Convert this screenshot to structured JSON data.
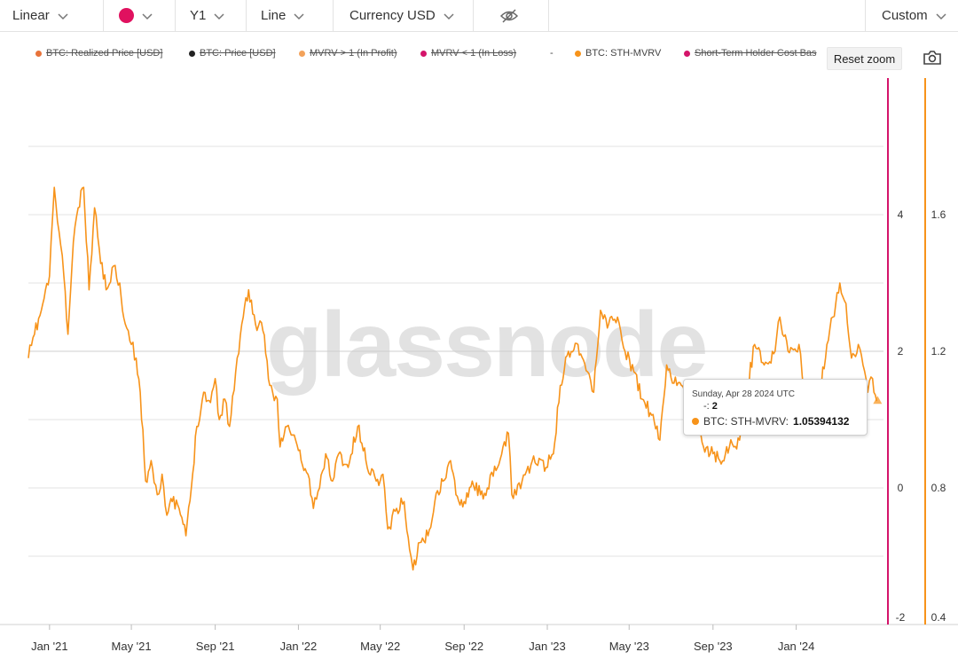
{
  "toolbar": {
    "scale": "Linear",
    "color": "#e0115f",
    "axis": "Y1",
    "line_type": "Line",
    "currency": "Currency USD",
    "range": "Custom"
  },
  "legend": {
    "items": [
      {
        "label": "BTC: Realized Price [USD]",
        "color": "#e8733a",
        "off": true
      },
      {
        "label": "BTC: Price [USD]",
        "color": "#222222",
        "off": true
      },
      {
        "label": "MVRV > 1 (In Profit)",
        "color": "#f3a25a",
        "off": true
      },
      {
        "label": "MVRV < 1 (In Loss)",
        "color": "#d4146a",
        "off": true
      },
      {
        "label": "-",
        "color": "",
        "off": false
      },
      {
        "label": "BTC: STH-MVRV",
        "color": "#f7931a",
        "off": false
      },
      {
        "label": "Short-Term Holder Cost Bas",
        "color": "#d4146a",
        "off": true
      }
    ]
  },
  "reset_zoom": "Reset zoom",
  "watermark": "glassnode",
  "tooltip": {
    "date": "Sunday, Apr 28 2024 UTC",
    "ref_label": "-:",
    "ref_value": "2",
    "series_label": "BTC: STH-MVRV:",
    "series_value": "1.05394132"
  },
  "chart_data": {
    "type": "line",
    "x_ticks": [
      "Jan '21",
      "May '21",
      "Sep '21",
      "Jan '22",
      "May '22",
      "Sep '22",
      "Jan '23",
      "May '23",
      "Sep '23",
      "Jan '24"
    ],
    "y_left_ticks": [
      "-2",
      "0",
      "2",
      "4"
    ],
    "y_right_ticks": [
      "0.4",
      "0.8",
      "1.2",
      "1.6"
    ],
    "y_left_range": [
      -2,
      6
    ],
    "y_right_range": [
      0.4,
      2.0
    ],
    "reference_value": 2,
    "reference_color": "#d4146a",
    "grid": true,
    "legend_position": "top",
    "series": [
      {
        "name": "BTC: STH-MVRV",
        "color": "#f7931a",
        "axis": "right",
        "points": [
          [
            "2020-12-01",
            1.18
          ],
          [
            "2020-12-10",
            1.25
          ],
          [
            "2020-12-20",
            1.32
          ],
          [
            "2021-01-01",
            1.42
          ],
          [
            "2021-01-08",
            1.68
          ],
          [
            "2021-01-15",
            1.55
          ],
          [
            "2021-01-22",
            1.42
          ],
          [
            "2021-01-28",
            1.25
          ],
          [
            "2021-02-05",
            1.52
          ],
          [
            "2021-02-12",
            1.62
          ],
          [
            "2021-02-20",
            1.68
          ],
          [
            "2021-02-28",
            1.38
          ],
          [
            "2021-03-08",
            1.62
          ],
          [
            "2021-03-15",
            1.5
          ],
          [
            "2021-03-25",
            1.38
          ],
          [
            "2021-04-05",
            1.45
          ],
          [
            "2021-04-14",
            1.4
          ],
          [
            "2021-04-22",
            1.28
          ],
          [
            "2021-05-01",
            1.22
          ],
          [
            "2021-05-08",
            1.18
          ],
          [
            "2021-05-14",
            1.08
          ],
          [
            "2021-05-22",
            0.82
          ],
          [
            "2021-05-30",
            0.88
          ],
          [
            "2021-06-08",
            0.78
          ],
          [
            "2021-06-15",
            0.84
          ],
          [
            "2021-06-22",
            0.72
          ],
          [
            "2021-06-30",
            0.76
          ],
          [
            "2021-07-10",
            0.74
          ],
          [
            "2021-07-20",
            0.66
          ],
          [
            "2021-07-28",
            0.8
          ],
          [
            "2021-08-05",
            0.98
          ],
          [
            "2021-08-15",
            1.08
          ],
          [
            "2021-08-25",
            1.05
          ],
          [
            "2021-09-01",
            1.12
          ],
          [
            "2021-09-07",
            1.0
          ],
          [
            "2021-09-15",
            1.06
          ],
          [
            "2021-09-22",
            0.98
          ],
          [
            "2021-10-01",
            1.14
          ],
          [
            "2021-10-10",
            1.28
          ],
          [
            "2021-10-20",
            1.38
          ],
          [
            "2021-10-30",
            1.28
          ],
          [
            "2021-11-10",
            1.26
          ],
          [
            "2021-11-20",
            1.1
          ],
          [
            "2021-12-01",
            1.06
          ],
          [
            "2021-12-05",
            0.92
          ],
          [
            "2021-12-15",
            0.98
          ],
          [
            "2021-12-28",
            0.94
          ],
          [
            "2022-01-05",
            0.88
          ],
          [
            "2022-01-15",
            0.84
          ],
          [
            "2022-01-23",
            0.74
          ],
          [
            "2022-02-01",
            0.8
          ],
          [
            "2022-02-10",
            0.9
          ],
          [
            "2022-02-20",
            0.82
          ],
          [
            "2022-03-01",
            0.9
          ],
          [
            "2022-03-15",
            0.86
          ],
          [
            "2022-03-29",
            0.98
          ],
          [
            "2022-04-10",
            0.88
          ],
          [
            "2022-04-25",
            0.82
          ],
          [
            "2022-05-05",
            0.84
          ],
          [
            "2022-05-12",
            0.68
          ],
          [
            "2022-05-25",
            0.74
          ],
          [
            "2022-06-05",
            0.76
          ],
          [
            "2022-06-13",
            0.62
          ],
          [
            "2022-06-18",
            0.56
          ],
          [
            "2022-06-28",
            0.64
          ],
          [
            "2022-07-10",
            0.66
          ],
          [
            "2022-07-20",
            0.76
          ],
          [
            "2022-08-01",
            0.82
          ],
          [
            "2022-08-12",
            0.88
          ],
          [
            "2022-08-20",
            0.78
          ],
          [
            "2022-09-01",
            0.76
          ],
          [
            "2022-09-13",
            0.82
          ],
          [
            "2022-09-25",
            0.78
          ],
          [
            "2022-10-05",
            0.8
          ],
          [
            "2022-10-20",
            0.86
          ],
          [
            "2022-11-05",
            0.96
          ],
          [
            "2022-11-10",
            0.78
          ],
          [
            "2022-11-25",
            0.82
          ],
          [
            "2022-12-10",
            0.88
          ],
          [
            "2022-12-30",
            0.86
          ],
          [
            "2023-01-10",
            0.9
          ],
          [
            "2023-01-20",
            1.1
          ],
          [
            "2023-02-01",
            1.2
          ],
          [
            "2023-02-15",
            1.22
          ],
          [
            "2023-03-01",
            1.14
          ],
          [
            "2023-03-10",
            1.08
          ],
          [
            "2023-03-20",
            1.32
          ],
          [
            "2023-04-01",
            1.28
          ],
          [
            "2023-04-14",
            1.3
          ],
          [
            "2023-04-25",
            1.2
          ],
          [
            "2023-05-08",
            1.14
          ],
          [
            "2023-05-20",
            1.06
          ],
          [
            "2023-06-01",
            1.02
          ],
          [
            "2023-06-15",
            0.94
          ],
          [
            "2023-06-25",
            1.16
          ],
          [
            "2023-07-10",
            1.1
          ],
          [
            "2023-07-25",
            1.06
          ],
          [
            "2023-08-10",
            1.02
          ],
          [
            "2023-08-18",
            0.92
          ],
          [
            "2023-09-01",
            0.9
          ],
          [
            "2023-09-11",
            0.88
          ],
          [
            "2023-09-25",
            0.92
          ],
          [
            "2023-10-10",
            0.94
          ],
          [
            "2023-10-20",
            1.08
          ],
          [
            "2023-11-01",
            1.22
          ],
          [
            "2023-11-15",
            1.16
          ],
          [
            "2023-12-01",
            1.2
          ],
          [
            "2023-12-08",
            1.3
          ],
          [
            "2023-12-20",
            1.2
          ],
          [
            "2024-01-05",
            1.22
          ],
          [
            "2024-01-12",
            1.08
          ],
          [
            "2024-01-23",
            1.0
          ],
          [
            "2024-02-05",
            1.08
          ],
          [
            "2024-02-15",
            1.22
          ],
          [
            "2024-02-28",
            1.34
          ],
          [
            "2024-03-05",
            1.4
          ],
          [
            "2024-03-14",
            1.34
          ],
          [
            "2024-03-22",
            1.18
          ],
          [
            "2024-04-01",
            1.22
          ],
          [
            "2024-04-08",
            1.16
          ],
          [
            "2024-04-15",
            1.08
          ],
          [
            "2024-04-22",
            1.12
          ],
          [
            "2024-04-28",
            1.05394132
          ]
        ]
      }
    ]
  }
}
